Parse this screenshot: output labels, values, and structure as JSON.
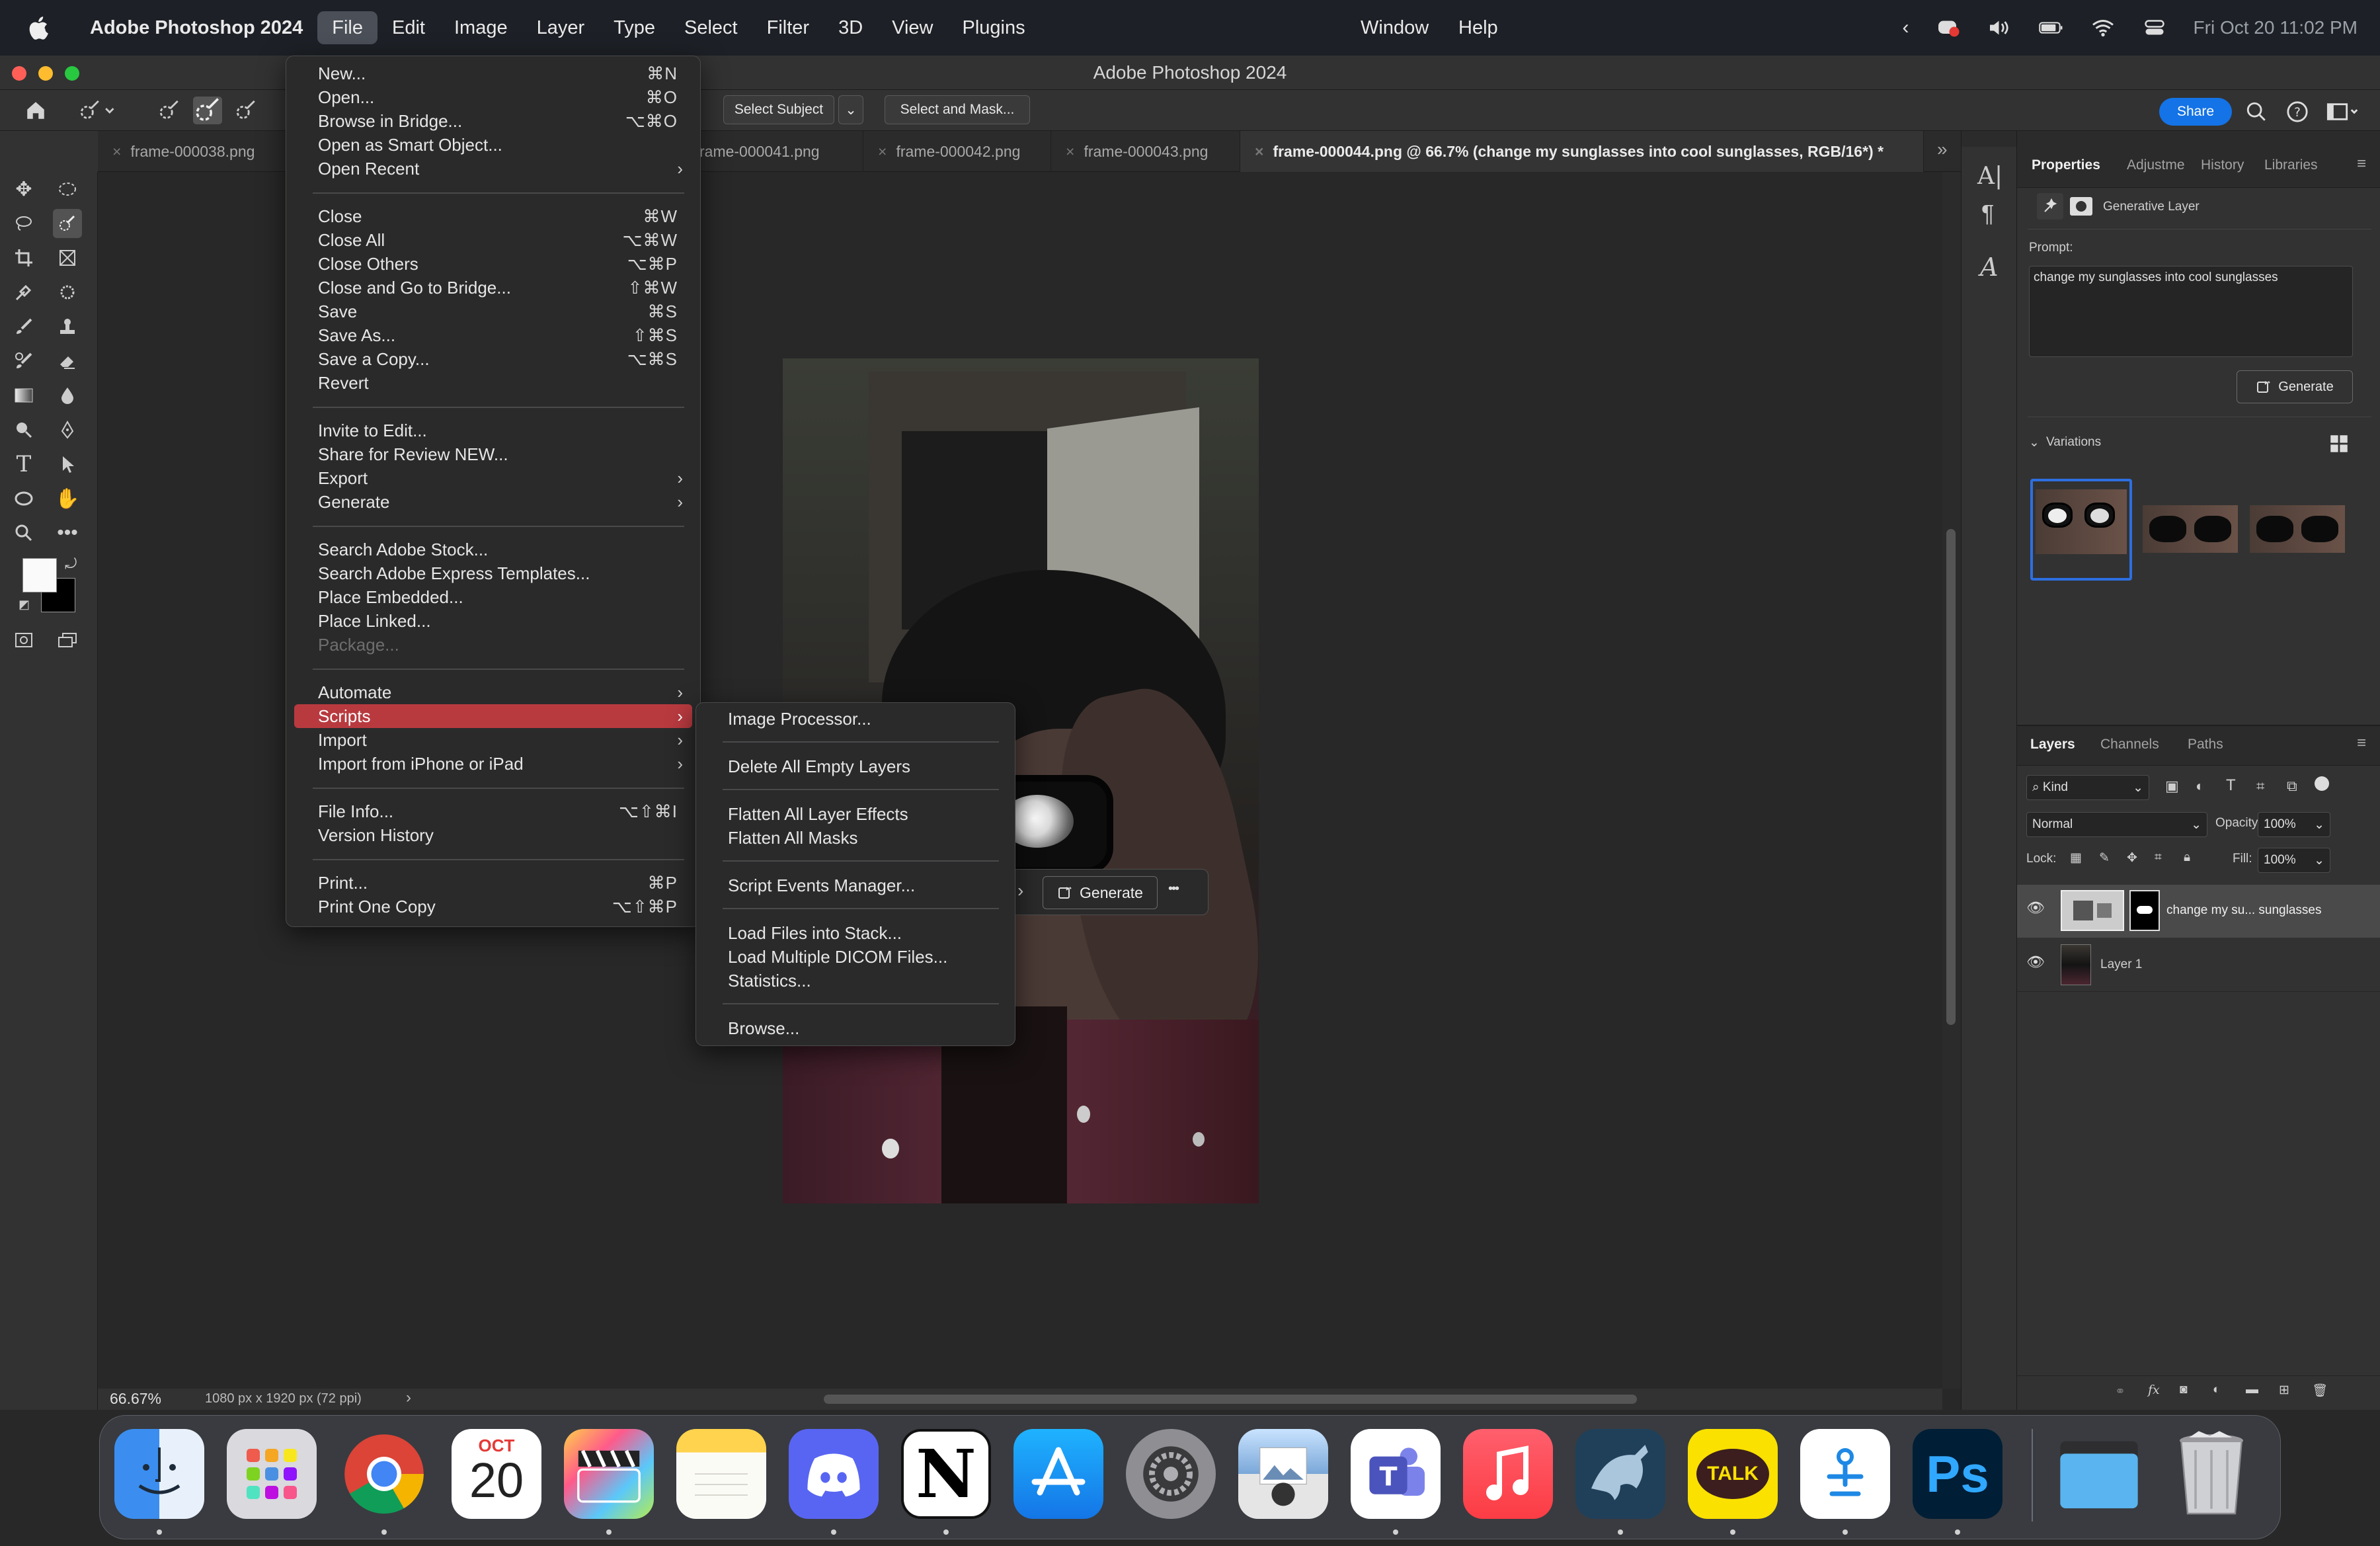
{
  "menubar": {
    "app_name": "Adobe Photoshop 2024",
    "menus": [
      "File",
      "Edit",
      "Image",
      "Layer",
      "Type",
      "Select",
      "Filter",
      "3D",
      "View",
      "Plugins"
    ],
    "menus_right": [
      "Window",
      "Help"
    ],
    "datetime": "Fri Oct 20  11:02 PM"
  },
  "window": {
    "title": "Adobe Photoshop 2024"
  },
  "options": {
    "select_subject": "Select Subject",
    "select_and_mask": "Select and Mask...",
    "share": "Share"
  },
  "tabs": [
    {
      "label": "frame-000038.png"
    },
    {
      "label": "rame-000041.png"
    },
    {
      "label": "frame-000042.png"
    },
    {
      "label": "frame-000043.png"
    },
    {
      "label": "frame-000044.png @ 66.7% (change my sunglasses into cool sunglasses, RGB/16*) *"
    }
  ],
  "file_menu": {
    "items": [
      {
        "label": "New...",
        "shortcut": "⌘N"
      },
      {
        "label": "Open...",
        "shortcut": "⌘O"
      },
      {
        "label": "Browse in Bridge...",
        "shortcut": "⌥⌘O"
      },
      {
        "label": "Open as Smart Object...",
        "shortcut": ""
      },
      {
        "label": "Open Recent",
        "shortcut": ""
      },
      {
        "label": "Close",
        "shortcut": "⌘W"
      },
      {
        "label": "Close All",
        "shortcut": "⌥⌘W"
      },
      {
        "label": "Close Others",
        "shortcut": "⌥⌘P"
      },
      {
        "label": "Close and Go to Bridge...",
        "shortcut": "⇧⌘W"
      },
      {
        "label": "Save",
        "shortcut": "⌘S"
      },
      {
        "label": "Save As...",
        "shortcut": "⇧⌘S"
      },
      {
        "label": "Save a Copy...",
        "shortcut": "⌥⌘S"
      },
      {
        "label": "Revert",
        "shortcut": ""
      },
      {
        "label": "Invite to Edit...",
        "shortcut": ""
      },
      {
        "label": "Share for Review NEW...",
        "shortcut": ""
      },
      {
        "label": "Export",
        "shortcut": ""
      },
      {
        "label": "Generate",
        "shortcut": ""
      },
      {
        "label": "Search Adobe Stock...",
        "shortcut": ""
      },
      {
        "label": "Search Adobe Express Templates...",
        "shortcut": ""
      },
      {
        "label": "Place Embedded...",
        "shortcut": ""
      },
      {
        "label": "Place Linked...",
        "shortcut": ""
      },
      {
        "label": "Package...",
        "shortcut": ""
      },
      {
        "label": "Automate",
        "shortcut": ""
      },
      {
        "label": "Scripts",
        "shortcut": ""
      },
      {
        "label": "Import",
        "shortcut": ""
      },
      {
        "label": "Import from iPhone or iPad",
        "shortcut": ""
      },
      {
        "label": "File Info...",
        "shortcut": "⌥⇧⌘I"
      },
      {
        "label": "Version History",
        "shortcut": ""
      },
      {
        "label": "Print...",
        "shortcut": "⌘P"
      },
      {
        "label": "Print One Copy",
        "shortcut": "⌥⇧⌘P"
      }
    ]
  },
  "scripts_menu": {
    "items": [
      {
        "label": "Image Processor..."
      },
      {
        "label": "Delete All Empty Layers"
      },
      {
        "label": "Flatten All Layer Effects"
      },
      {
        "label": "Flatten All Masks"
      },
      {
        "label": "Script Events Manager..."
      },
      {
        "label": "Load Files into Stack..."
      },
      {
        "label": "Load Multiple DICOM Files..."
      },
      {
        "label": "Statistics..."
      },
      {
        "label": "Browse..."
      }
    ]
  },
  "contextual": {
    "generate": "Generate",
    "more": "•••"
  },
  "properties": {
    "tabs": [
      "Properties",
      "Adjustme",
      "History",
      "Libraries"
    ],
    "layer_type": "Generative Layer",
    "prompt_label": "Prompt:",
    "prompt_value": "change my sunglasses into cool sunglasses",
    "generate": "Generate",
    "variations_label": "Variations"
  },
  "layers_panel": {
    "tabs": [
      "Layers",
      "Channels",
      "Paths"
    ],
    "kind": "Kind",
    "blend_mode": "Normal",
    "opacity_label": "Opacity:",
    "opacity": "100%",
    "lock_label": "Lock:",
    "fill_label": "Fill:",
    "fill": "100%",
    "layers": [
      {
        "name": "change my su... sunglasses"
      },
      {
        "name": "Layer 1"
      }
    ]
  },
  "statusbar": {
    "zoom": "66.67%",
    "doc_size": "1080 px x 1920 px (72 ppi)"
  },
  "dock": {
    "calendar_month": "OCT",
    "calendar_day": "20",
    "kakao": "TALK",
    "ps": "Ps",
    "notion": "N",
    "apps": [
      "Finder",
      "Launchpad",
      "Chrome",
      "Calendar",
      "Final Cut",
      "Notes",
      "Discord",
      "Notion",
      "App Store",
      "System Settings",
      "Preview",
      "Teams",
      "Music",
      "MySQL Workbench",
      "KakaoTalk",
      "Clock",
      "Photoshop",
      "Folder",
      "Trash"
    ]
  }
}
